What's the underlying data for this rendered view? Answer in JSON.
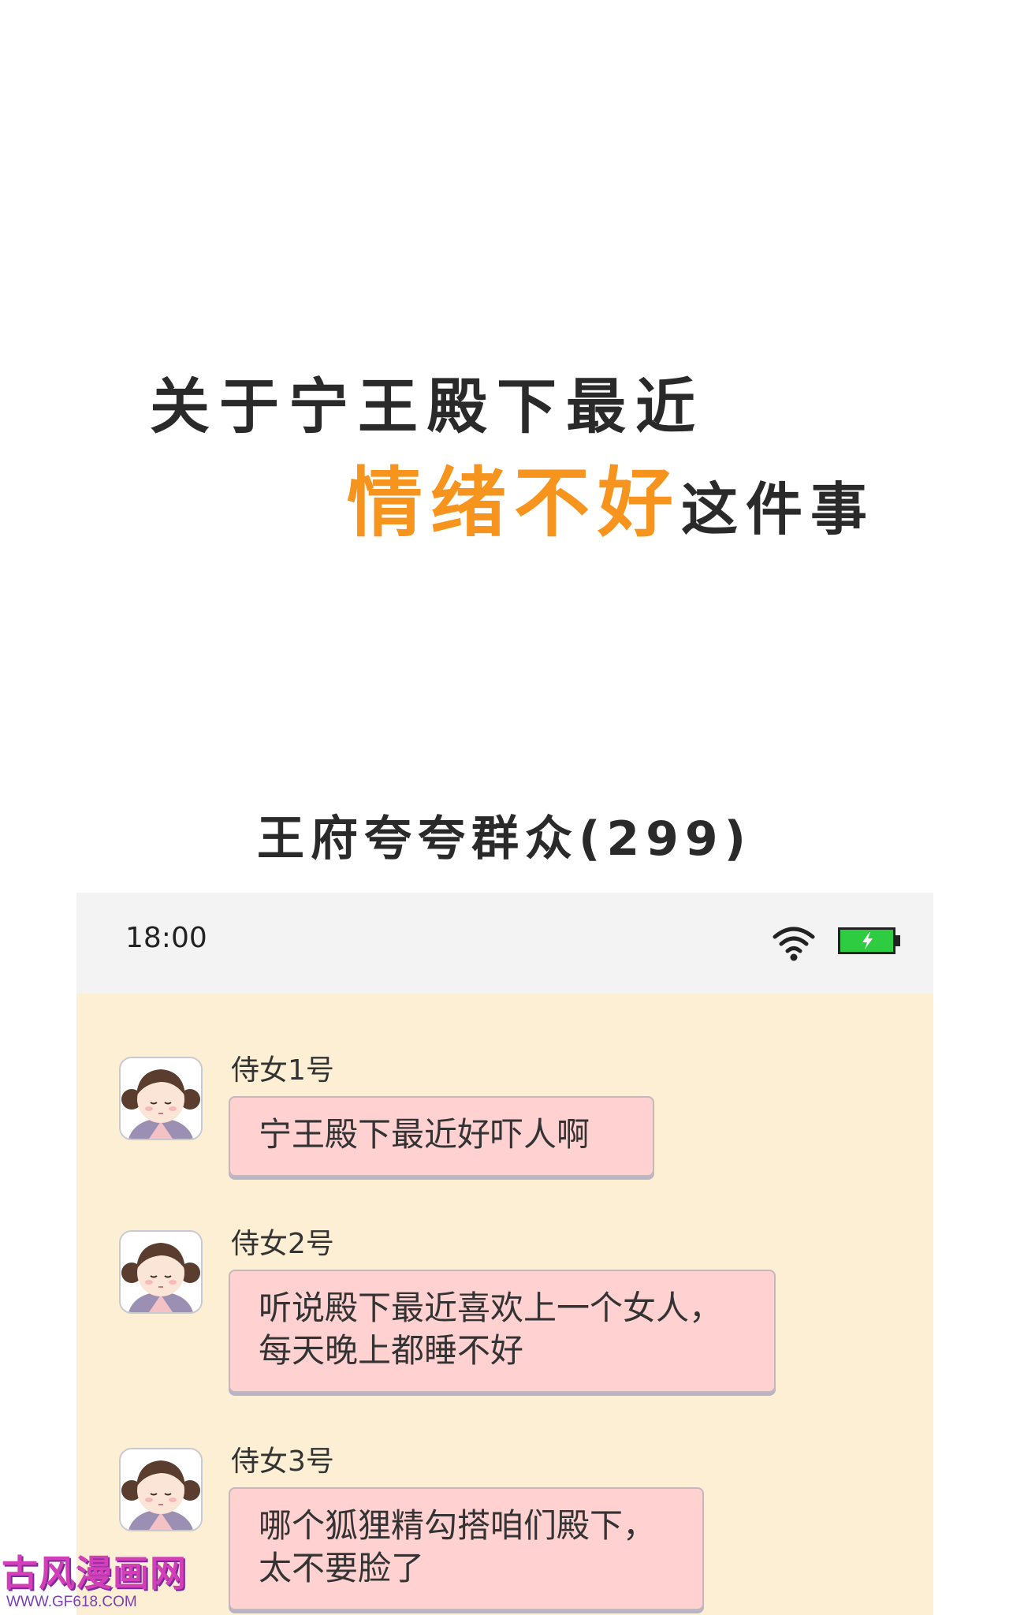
{
  "title": {
    "line1": "关于宁王殿下最近",
    "line2_accent": "情绪不好",
    "line2_rest": "这件事",
    "accent_color": "#f7941e"
  },
  "group": {
    "name": "王府夸夸群众(299)"
  },
  "status_bar": {
    "time": "18:00",
    "icons": [
      "wifi-icon",
      "battery-charging-icon"
    ],
    "battery_color": "#2ecc40"
  },
  "messages": [
    {
      "sender": "侍女1号",
      "avatar": "maid-avatar-icon",
      "lines": [
        "宁王殿下最近好吓人啊"
      ]
    },
    {
      "sender": "侍女2号",
      "avatar": "maid-avatar-icon",
      "lines": [
        "听说殿下最近喜欢上一个女人，",
        "每天晚上都睡不好"
      ]
    },
    {
      "sender": "侍女3号",
      "avatar": "maid-avatar-icon",
      "lines": [
        "哪个狐狸精勾搭咱们殿下，",
        "太不要脸了"
      ]
    }
  ],
  "colors": {
    "chat_background": "#fdefd3",
    "bubble": "#ffd1d1",
    "status_bar": "#f3f3f3"
  },
  "watermark": {
    "title": "古风漫画网",
    "url": "WWW.GF618.COM"
  }
}
